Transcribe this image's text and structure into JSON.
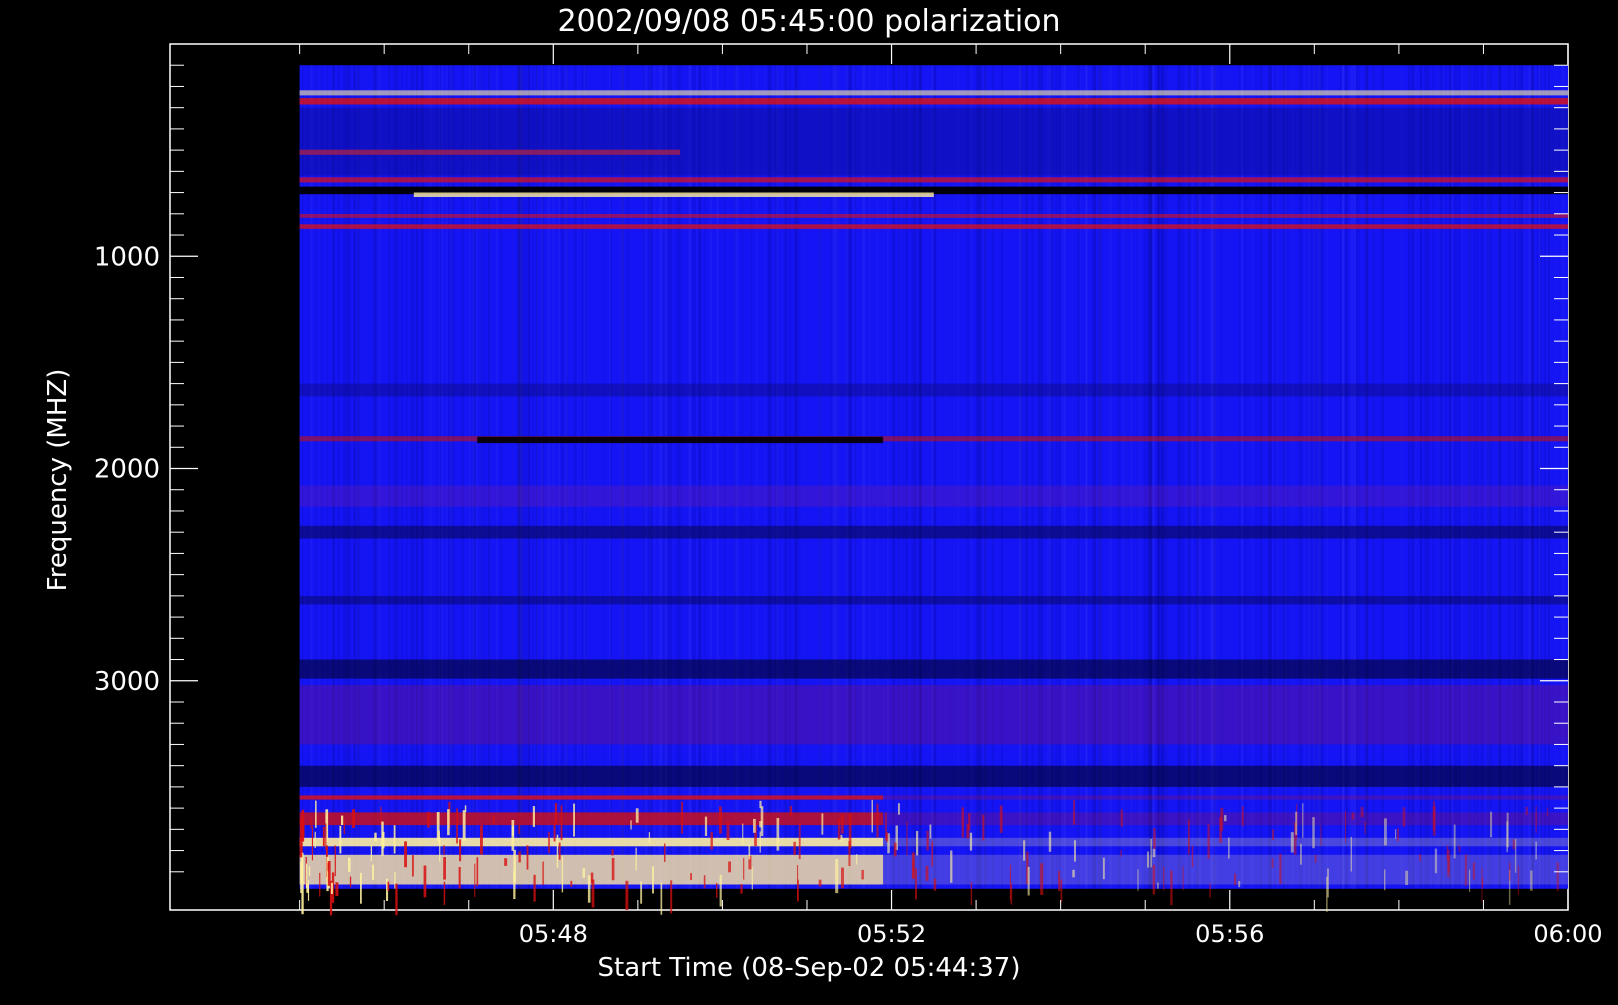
{
  "chart_data": {
    "type": "heatmap",
    "title": "2002/09/08 05:45:00 polarization",
    "xlabel": "Start Time (08-Sep-02 05:44:37)",
    "ylabel": "Frequency (MHZ)",
    "x_ticks": [
      "05:48",
      "05:52",
      "05:56",
      "06:00"
    ],
    "x_tick_values_min": [
      3.383,
      7.383,
      11.383,
      15.383
    ],
    "x_data_range_min": [
      0.383,
      15.383
    ],
    "x_axis_range_min": [
      -1.15,
      15.383
    ],
    "y_ticks": [
      "1000",
      "2000",
      "3000"
    ],
    "y_tick_values": [
      1000,
      2000,
      3000
    ],
    "y_data_range": [
      100,
      3980
    ],
    "y_axis_range": [
      0,
      4080
    ],
    "y_inverted": true,
    "colors": {
      "background": "#000000",
      "axes": "#ffffff",
      "base": "#1414f4",
      "dark": "#05055a",
      "red": "#d81010",
      "yellow": "#fff2a0"
    },
    "features": [
      {
        "kind": "line",
        "f": 230,
        "t0": 0,
        "t1": 1,
        "color": "#fff0a0",
        "opacity": 0.6,
        "mhz": 8
      },
      {
        "kind": "line",
        "f": 270,
        "t0": 0,
        "t1": 1,
        "color": "#e01010",
        "opacity": 0.8,
        "mhz": 10
      },
      {
        "kind": "line",
        "f": 510,
        "t0": 0,
        "t1": 0.3,
        "color": "#ff3030",
        "opacity": 0.9,
        "mhz": 8
      },
      {
        "kind": "line",
        "f": 640,
        "t0": 0,
        "t1": 1,
        "color": "#e01010",
        "opacity": 0.7,
        "mhz": 8
      },
      {
        "kind": "line",
        "f": 690,
        "t0": 0,
        "t1": 1,
        "color": "#000000",
        "opacity": 0.95,
        "mhz": 12
      },
      {
        "kind": "line",
        "f": 710,
        "t0": 0.09,
        "t1": 0.5,
        "color": "#fff0a0",
        "opacity": 0.8,
        "mhz": 7
      },
      {
        "kind": "line",
        "f": 810,
        "t0": 0,
        "t1": 1,
        "color": "#e01010",
        "opacity": 0.6,
        "mhz": 6
      },
      {
        "kind": "line",
        "f": 860,
        "t0": 0,
        "t1": 1,
        "color": "#e01010",
        "opacity": 0.75,
        "mhz": 7
      },
      {
        "kind": "band",
        "f0": 300,
        "f1": 620,
        "color": "#0a0a90",
        "opacity": 0.45
      },
      {
        "kind": "band",
        "f0": 1600,
        "f1": 1660,
        "color": "#0a0a60",
        "opacity": 0.35
      },
      {
        "kind": "line",
        "f": 1860,
        "t0": 0,
        "t1": 1,
        "color": "#c01010",
        "opacity": 0.6,
        "mhz": 8
      },
      {
        "kind": "line",
        "f": 1865,
        "t0": 0.14,
        "t1": 0.46,
        "color": "#000000",
        "opacity": 0.9,
        "mhz": 10
      },
      {
        "kind": "band",
        "f0": 2080,
        "f1": 2180,
        "color": "#8a1a8a",
        "opacity": 0.25
      },
      {
        "kind": "band",
        "f0": 2270,
        "f1": 2330,
        "color": "#05054a",
        "opacity": 0.55
      },
      {
        "kind": "band",
        "f0": 2600,
        "f1": 2640,
        "color": "#05054a",
        "opacity": 0.45
      },
      {
        "kind": "band",
        "f0": 2900,
        "f1": 2990,
        "color": "#02022a",
        "opacity": 0.6
      },
      {
        "kind": "band",
        "f0": 3020,
        "f1": 3300,
        "color": "#8a1060",
        "opacity": 0.3
      },
      {
        "kind": "band",
        "f0": 3400,
        "f1": 3500,
        "color": "#02022a",
        "opacity": 0.6
      },
      {
        "kind": "band",
        "f0": 3540,
        "f1": 3560,
        "color": "#e01010",
        "opacity": 0.8
      },
      {
        "kind": "band",
        "f0": 3620,
        "f1": 3680,
        "color": "#d01010",
        "opacity": 0.8
      },
      {
        "kind": "band",
        "f0": 3740,
        "f1": 3780,
        "color": "#fff0a0",
        "opacity": 0.9
      },
      {
        "kind": "band",
        "f0": 3820,
        "f1": 3960,
        "color": "#ffe8a0",
        "opacity": 0.8
      }
    ]
  }
}
